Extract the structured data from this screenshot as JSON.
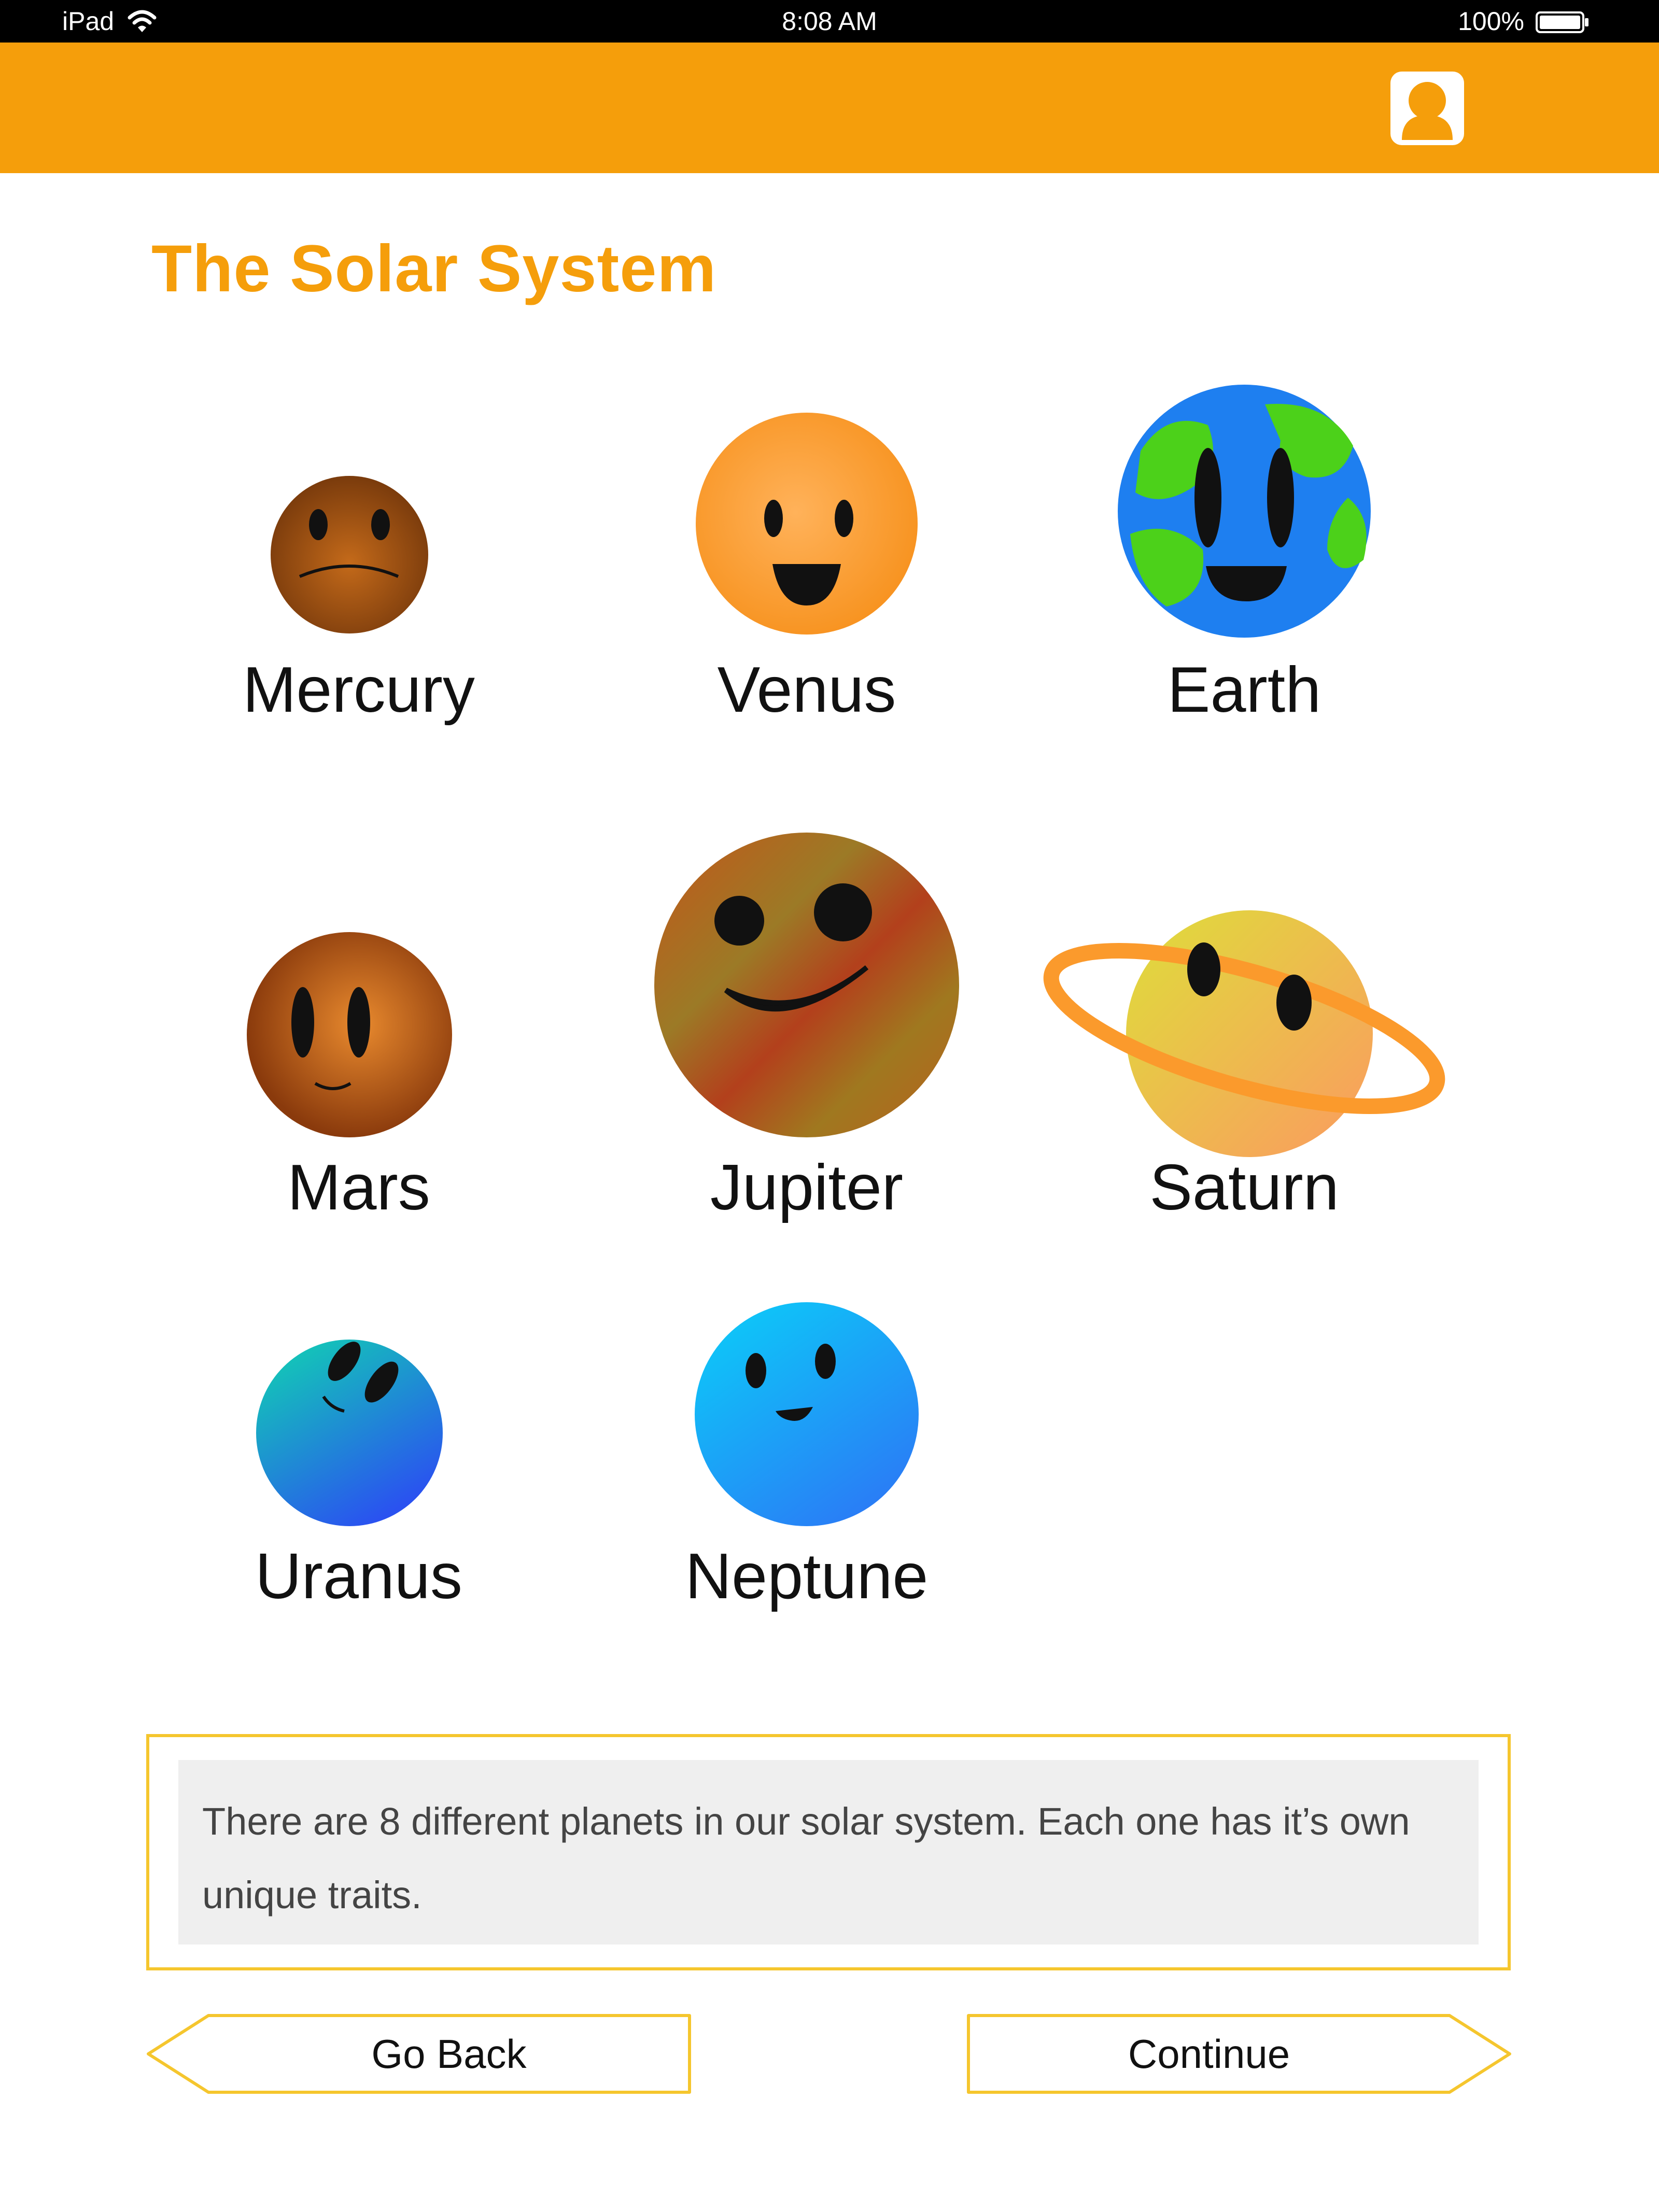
{
  "status_bar": {
    "device": "iPad",
    "time": "8:08 AM",
    "battery": "100%"
  },
  "header": {
    "profile_icon": "user-avatar-icon",
    "accent_color": "#f59e0b"
  },
  "page": {
    "title": "The Solar System"
  },
  "planets": [
    {
      "name": "Mercury",
      "color": "#9c4f12"
    },
    {
      "name": "Venus",
      "color": "#fb9a2c"
    },
    {
      "name": "Earth",
      "color": "#1e7ff0"
    },
    {
      "name": "Mars",
      "color": "#b8561a"
    },
    {
      "name": "Jupiter",
      "color": "#a8461a"
    },
    {
      "name": "Saturn",
      "color": "#f4c34c"
    },
    {
      "name": "Uranus",
      "color": "#1e8fe0"
    },
    {
      "name": "Neptune",
      "color": "#1aa6f5"
    }
  ],
  "info": {
    "text": "There are 8 different planets in our solar system. Each one has it’s own unique traits."
  },
  "nav": {
    "back_label": "Go Back",
    "continue_label": "Continue"
  },
  "colors": {
    "border": "#f5c62e",
    "info_bg": "#efefef"
  }
}
